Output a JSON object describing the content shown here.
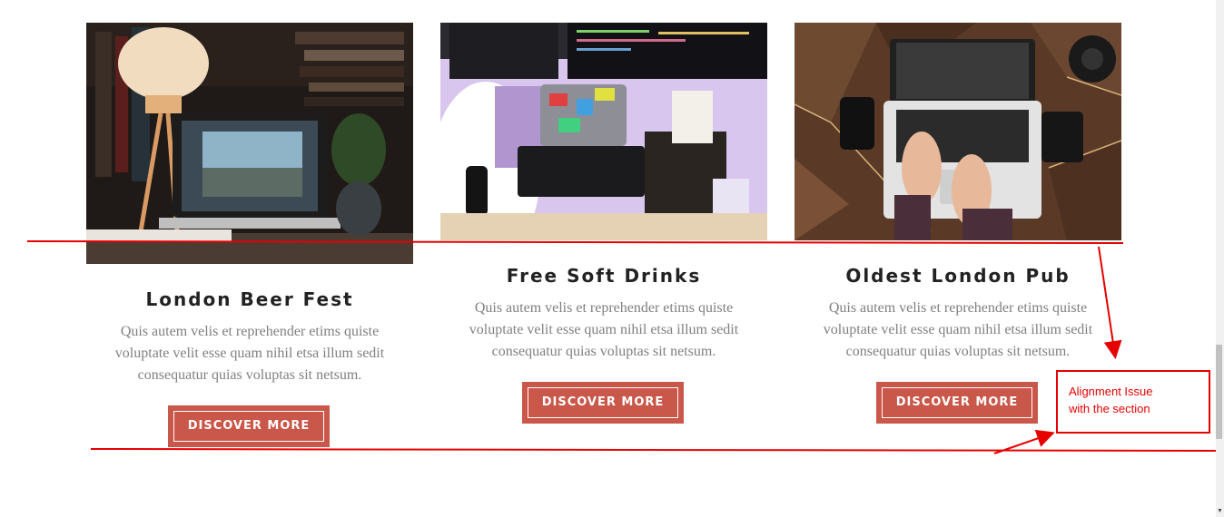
{
  "cards": [
    {
      "title": "London Beer Fest",
      "image_icon": "laptop-desk-photo",
      "description": "Quis autem velis et reprehender etims quiste voluptate velit esse quam nihil etsa illum sedit consequatur quias voluptas sit netsum.",
      "button_label": "DISCOVER MORE"
    },
    {
      "title": "Free Soft Drinks",
      "image_icon": "workstation-keyboard-photo",
      "description": "Quis autem velis et reprehender etims quiste voluptate velit esse quam nihil etsa illum sedit consequatur quias voluptas sit netsum.",
      "button_label": "DISCOVER MORE"
    },
    {
      "title": "Oldest London Pub",
      "image_icon": "laptop-typing-photo",
      "description": "Quis autem velis et reprehender etims quiste voluptate velit esse quam nihil etsa illum sedit consequatur quias voluptas sit netsum.",
      "button_label": "DISCOVER MORE"
    }
  ],
  "annotation": {
    "callout_line1": "Alignment Issue",
    "callout_line2": "with the section",
    "color": "#e60000"
  },
  "colors": {
    "accent": "#c9574a",
    "title": "#222222",
    "body_text": "#808080"
  }
}
